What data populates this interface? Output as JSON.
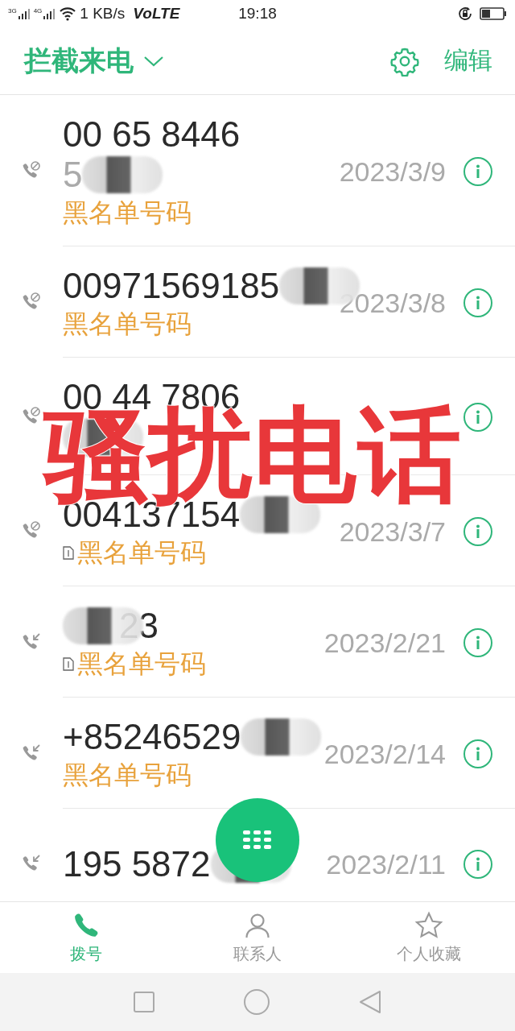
{
  "status_bar": {
    "network_1": "3G",
    "network_2": "4G",
    "speed": "1 KB/s",
    "volte": "VoLTE",
    "time": "19:18"
  },
  "header": {
    "title": "拦截来电",
    "action": "编辑"
  },
  "calls": [
    {
      "kind": "blocked",
      "number": "00 65 8446",
      "number_line2": "5",
      "blur_before": false,
      "blur_after": true,
      "blur_below": false,
      "sim": false,
      "label": "黑名单号码",
      "date": "2023/3/9"
    },
    {
      "kind": "blocked",
      "number": "00971569185",
      "blur_before": false,
      "blur_after": true,
      "blur_below": false,
      "sim": false,
      "label": "黑名单号码",
      "date": "2023/3/8"
    },
    {
      "kind": "blocked",
      "number": "00 44 7806",
      "blur_before": false,
      "blur_after": false,
      "blur_below": true,
      "sim": false
    },
    {
      "kind": "blocked",
      "number": "004137154",
      "blur_before": false,
      "blur_after": true,
      "blur_below": false,
      "sim": true,
      "label": "黑名单号码",
      "date": "2023/3/7"
    },
    {
      "kind": "incoming",
      "number": "23",
      "blur_before": true,
      "blur_after": false,
      "blur_below": false,
      "sim": true,
      "label": "黑名单号码",
      "date": "2023/2/21"
    },
    {
      "kind": "incoming",
      "number": "+85246529",
      "blur_before": false,
      "blur_after": true,
      "blur_below": false,
      "sim": false,
      "label": "黑名单号码",
      "date": "2023/2/14"
    },
    {
      "kind": "incoming",
      "number": "195 5872",
      "blur_before": false,
      "blur_after": true,
      "blur_below": false,
      "sim": false,
      "date": "2023/2/11"
    }
  ],
  "tabs": [
    {
      "label": "拨号",
      "selected": true
    },
    {
      "label": "联系人",
      "selected": false
    },
    {
      "label": "个人收藏",
      "selected": false
    }
  ],
  "overlay_caption": "骚扰电话"
}
